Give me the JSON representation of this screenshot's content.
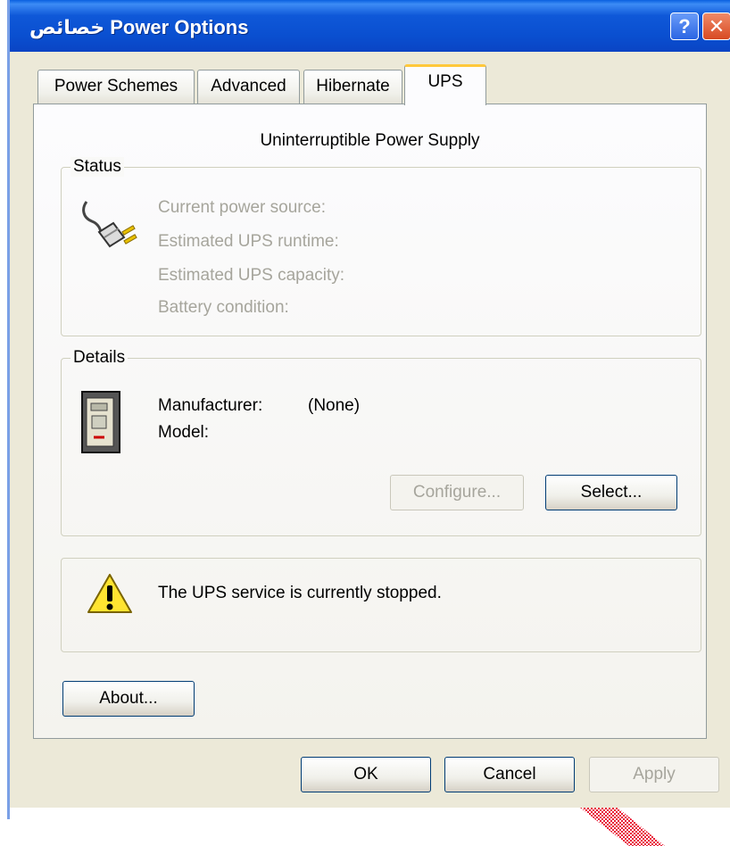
{
  "window": {
    "title_prefix": "خصائص",
    "title": "Power Options",
    "help_label": "?",
    "close_label": "✕"
  },
  "tabs": [
    {
      "label": "Power Schemes",
      "active": false
    },
    {
      "label": "Advanced",
      "active": false
    },
    {
      "label": "Hibernate",
      "active": false
    },
    {
      "label": "UPS",
      "active": true
    }
  ],
  "ups": {
    "heading": "Uninterruptible Power Supply",
    "status": {
      "legend": "Status",
      "icon": "power-plug-icon",
      "lines": [
        "Current power source:",
        "Estimated UPS runtime:",
        "Estimated UPS capacity:",
        "Battery condition:"
      ]
    },
    "details": {
      "legend": "Details",
      "icon": "ups-device-icon",
      "manufacturer_label": "Manufacturer:",
      "manufacturer_value": "(None)",
      "model_label": "Model:",
      "configure_label": "Configure...",
      "select_label": "Select..."
    },
    "warning": {
      "icon": "warning-icon",
      "message": "The UPS service is currently stopped."
    },
    "about_label": "About..."
  },
  "footer": {
    "ok_label": "OK",
    "cancel_label": "Cancel",
    "apply_label": "Apply"
  },
  "colors": {
    "titlebar": "#0a4fd0",
    "active_tab_accent": "#ffc83c",
    "disabled_text": "#a6a59c",
    "dialog_bg": "#ece9d8"
  }
}
